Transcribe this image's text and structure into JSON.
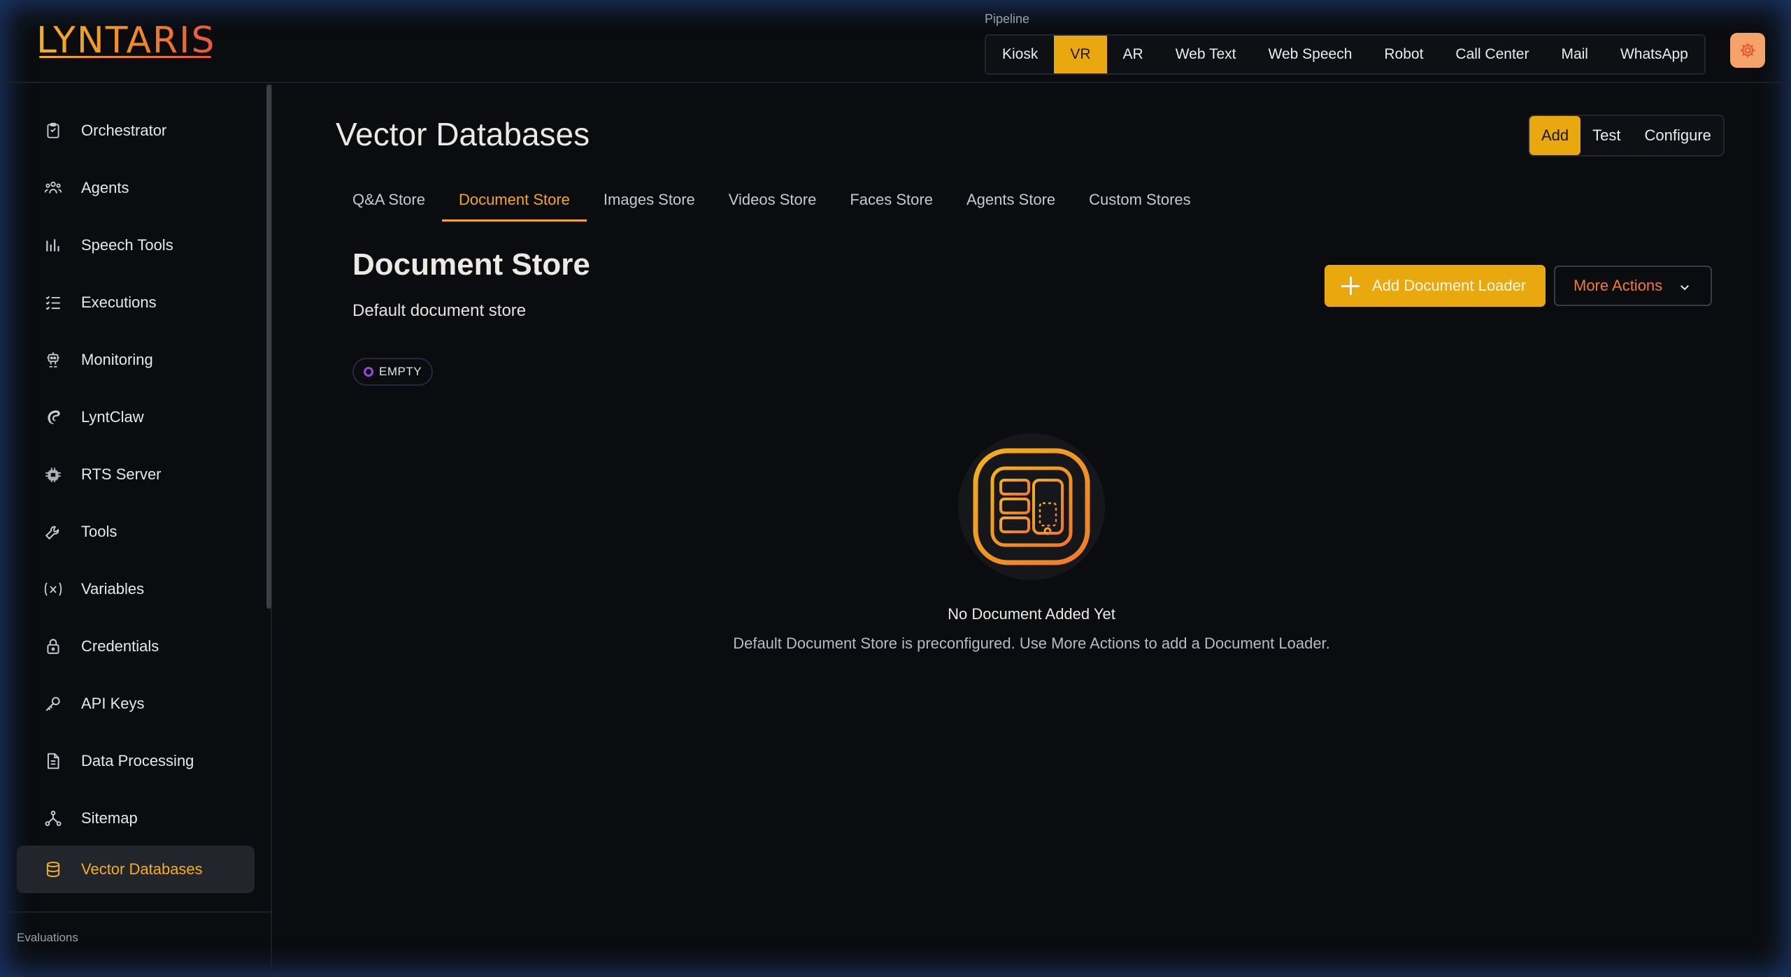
{
  "app": {
    "logo_text": "LYNTARIS"
  },
  "pipeline": {
    "label": "Pipeline",
    "items": [
      "Kiosk",
      "VR",
      "AR",
      "Web Text",
      "Web Speech",
      "Robot",
      "Call Center",
      "Mail",
      "WhatsApp"
    ],
    "active": "VR"
  },
  "sidebar": {
    "items": [
      {
        "label": "Orchestrator",
        "icon": "clipboard-icon"
      },
      {
        "label": "Agents",
        "icon": "users-icon"
      },
      {
        "label": "Speech Tools",
        "icon": "bar-chart-icon"
      },
      {
        "label": "Executions",
        "icon": "list-check-icon"
      },
      {
        "label": "Monitoring",
        "icon": "robot-icon"
      },
      {
        "label": "LyntClaw",
        "icon": "claw-icon"
      },
      {
        "label": "RTS Server",
        "icon": "server-icon"
      },
      {
        "label": "Tools",
        "icon": "wrench-icon"
      },
      {
        "label": "Variables",
        "icon": "variable-icon"
      },
      {
        "label": "Credentials",
        "icon": "lock-icon"
      },
      {
        "label": "API Keys",
        "icon": "key-icon"
      },
      {
        "label": "Data Processing",
        "icon": "file-icon"
      },
      {
        "label": "Sitemap",
        "icon": "sitemap-icon"
      },
      {
        "label": "Vector Databases",
        "icon": "database-icon"
      }
    ],
    "active": "Vector Databases",
    "section_label": "Evaluations"
  },
  "main": {
    "title": "Vector Databases",
    "actions": [
      "Add",
      "Test",
      "Configure"
    ],
    "active_action": "Add",
    "tabs": [
      "Q&A Store",
      "Document Store",
      "Images Store",
      "Videos Store",
      "Faces Store",
      "Agents Store",
      "Custom Stores"
    ],
    "active_tab": "Document Store",
    "store": {
      "title": "Document Store",
      "subtitle": "Default document store",
      "add_loader_label": "Add Document Loader",
      "more_actions_label": "More Actions",
      "status_badge": "EMPTY",
      "empty_title": "No Document Added Yet",
      "empty_description": "Default Document Store is preconfigured. Use More Actions to add a Document Loader."
    }
  },
  "colors": {
    "accent": "#e9a90e",
    "accent_text": "#f2a71c",
    "more_actions": "#f07a34",
    "badge_dot": "#9b44e0",
    "background": "#0b0c0f"
  }
}
